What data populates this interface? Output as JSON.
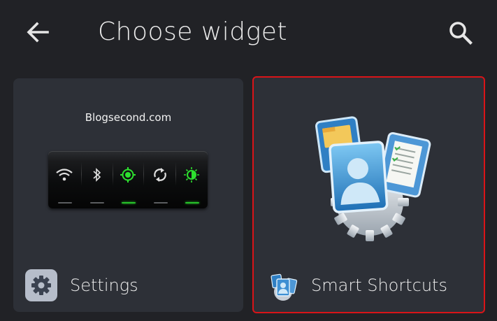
{
  "header": {
    "title": "Choose widget",
    "back_icon": "back-arrow-icon",
    "search_icon": "search-icon"
  },
  "widgets": [
    {
      "label": "Settings",
      "preview_text": "Blogsecond.com",
      "icon": "gear-icon",
      "selected": false,
      "toggles": [
        {
          "icon": "wifi-icon",
          "on": false
        },
        {
          "icon": "bluetooth-icon",
          "on": false
        },
        {
          "icon": "gps-icon",
          "on": true
        },
        {
          "icon": "sync-icon",
          "on": false
        },
        {
          "icon": "brightness-icon",
          "on": true
        }
      ]
    },
    {
      "label": "Smart Shortcuts",
      "icon": "smart-shortcuts-icon",
      "selected": true
    }
  ],
  "colors": {
    "background": "#212226",
    "card": "#2d3037",
    "selection_border": "#d91418",
    "toggle_on": "#27c12a"
  }
}
